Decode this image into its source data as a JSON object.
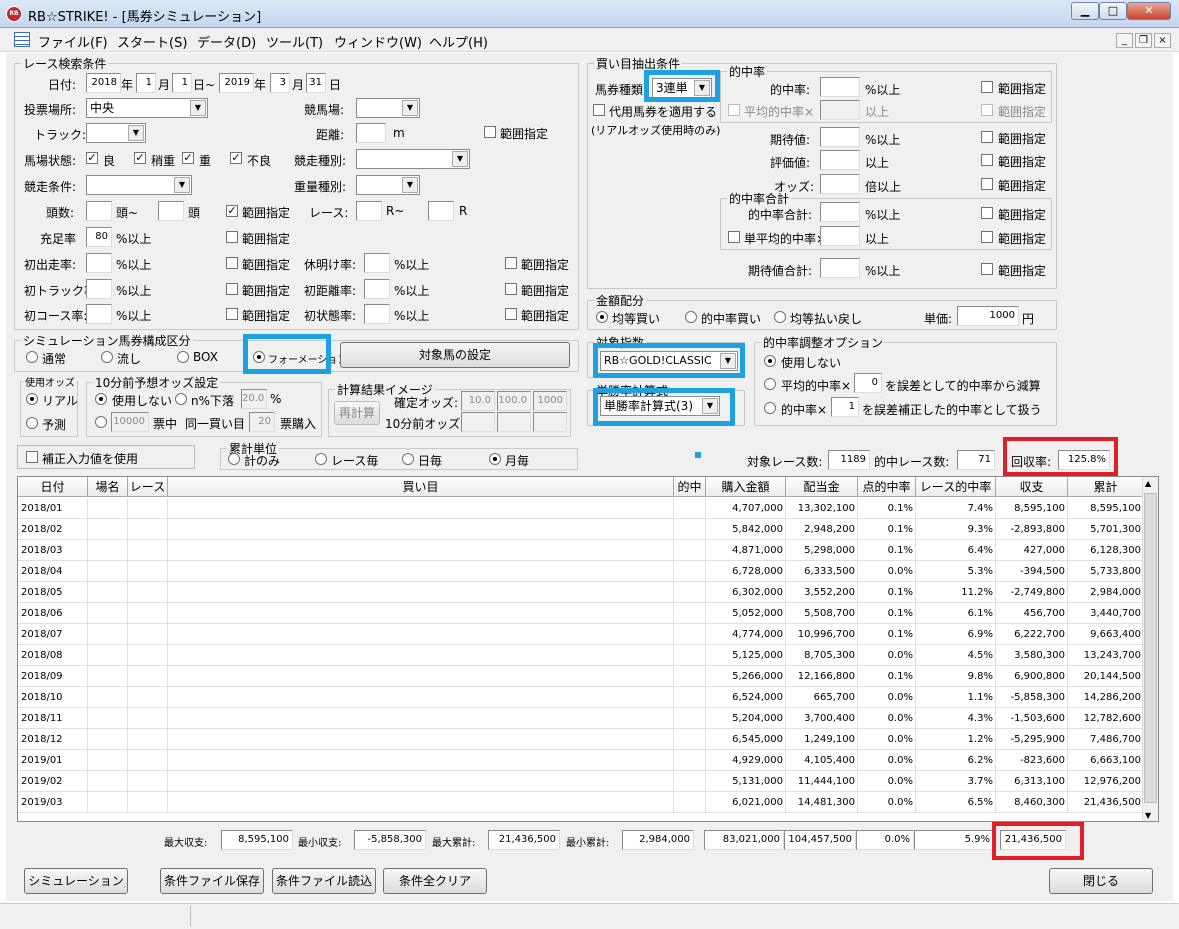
{
  "window": {
    "title": "RB☆STRIKE! - [馬券シミュレーション]",
    "logo_text": "RB",
    "min": "▁",
    "max": "□",
    "close": "✕"
  },
  "menu": [
    "ファイル(F)",
    "スタート(S)",
    "データ(D)",
    "ツール(T)",
    "ウィンドウ(W)",
    "ヘルプ(H)"
  ],
  "mdi": {
    "min": "_",
    "restore": "❐",
    "close": "×"
  },
  "race": {
    "legend": "レース検索条件",
    "date_label": "日付:",
    "from_year": "2018",
    "year_u": "年",
    "from_month": "1",
    "month_u": "月",
    "from_day": "1",
    "day_tilde": "日~",
    "to_year": "2019",
    "to_month": "3",
    "to_day": "31",
    "day_u": "日",
    "venue_label": "投票場所:",
    "venue_value": "中央",
    "course_label": "競馬場:",
    "track_label": "トラック:",
    "distance_label": "距離:",
    "distance_unit": "m",
    "range": "範囲指定",
    "cond_label": "馬場状態:",
    "cond": [
      "良",
      "稍重",
      "重",
      "不良"
    ],
    "race_type_label": "競走種別:",
    "race_cond_label": "競走条件:",
    "weight_label": "重量種別:",
    "heads_label": "頭数:",
    "heads_u": "頭~",
    "heads_u2": "頭",
    "race_label": "レース:",
    "race_u": "R~",
    "race_u2": "R",
    "fill_label": "充足率",
    "fill_value": "80",
    "pct_over": "%以上",
    "first_run": "初出走率:",
    "rest": "休明け率:",
    "first_track": "初トラック率:",
    "first_dist": "初距離率:",
    "first_course": "初コース率:",
    "first_state": "初状態率:"
  },
  "composition": {
    "legend": "シミュレーション馬券構成区分",
    "options": [
      "通常",
      "流し",
      "BOX",
      "フォーメーション"
    ],
    "button": "対象馬の設定"
  },
  "odds_use": {
    "legend": "使用オッズ",
    "options": [
      "リアル",
      "予測"
    ]
  },
  "odds10": {
    "legend": "10分前予想オッズ設定",
    "no_use": "使用しない",
    "drop": "n%下落",
    "drop_value": "20.0",
    "pct": "%",
    "amount": "10000",
    "ticket_u": "票中",
    "same": "同一買い目",
    "same_value": "20",
    "buy_u": "票購入"
  },
  "calc": {
    "legend": "計算結果イメージ",
    "button": "再計算",
    "confirmed": "確定オッズ:",
    "confirmed_vals": [
      "10.0",
      "100.0",
      "1000"
    ],
    "before10": "10分前オッズ:"
  },
  "correction": {
    "label": "補正入力値を使用"
  },
  "unit": {
    "legend": "累計単位",
    "options": [
      "計のみ",
      "レース毎",
      "日毎",
      "月毎"
    ]
  },
  "buy": {
    "legend": "買い目抽出条件",
    "type_label": "馬券種類",
    "type_value": "3連単",
    "substitute": "代用馬券を適用する",
    "real_note": "(リアルオッズ使用時のみ)",
    "hit_legend": "的中率",
    "hit_rate": "的中率:",
    "avg_hit": "平均的中率×",
    "expect": "期待値:",
    "eval": "評価値:",
    "odds": "オッズ:",
    "over": "%以上",
    "over2": "以上",
    "times": "倍以上",
    "sum_legend": "的中率合計",
    "sum_rate": "的中率合計:",
    "single_avg": "単平均的中率×",
    "expect_sum": "期待値合計:",
    "range": "範囲指定"
  },
  "money": {
    "legend": "金額配分",
    "options": [
      "均等買い",
      "的中率買い",
      "均等払い戻し"
    ],
    "unit_label": "単価:",
    "unit_value": "1000",
    "yen": "円"
  },
  "index": {
    "legend": "対象指数",
    "value": "RB☆GOLD!CLASSIC"
  },
  "formula": {
    "legend": "単勝率計算式",
    "value": "単勝率計算式(3)"
  },
  "adjust": {
    "legend": "的中率調整オプション",
    "no_use": "使用しない",
    "opt2_a": "平均的中率×",
    "opt2_val": "0",
    "opt2_b": "を誤差として的中率から減算",
    "opt3_a": "的中率×",
    "opt3_val": "1",
    "opt3_b": "を誤差補正した的中率として扱う"
  },
  "summary": {
    "races_label": "対象レース数:",
    "races": "1189",
    "hit_label": "的中レース数:",
    "hits": "71",
    "recovery_label": "回収率:",
    "recovery": "125.8%"
  },
  "table": {
    "headers": [
      "日付",
      "場名",
      "レース",
      "買い目",
      "的中",
      "購入金額",
      "配当金",
      "点的中率",
      "レース的中率",
      "収支",
      "累計"
    ],
    "rows": [
      [
        "2018/01",
        "4,707,000",
        "13,302,100",
        "0.1%",
        "7.4%",
        "8,595,100",
        "8,595,100"
      ],
      [
        "2018/02",
        "5,842,000",
        "2,948,200",
        "0.1%",
        "9.3%",
        "-2,893,800",
        "5,701,300"
      ],
      [
        "2018/03",
        "4,871,000",
        "5,298,000",
        "0.1%",
        "6.4%",
        "427,000",
        "6,128,300"
      ],
      [
        "2018/04",
        "6,728,000",
        "6,333,500",
        "0.0%",
        "5.3%",
        "-394,500",
        "5,733,800"
      ],
      [
        "2018/05",
        "6,302,000",
        "3,552,200",
        "0.1%",
        "11.2%",
        "-2,749,800",
        "2,984,000"
      ],
      [
        "2018/06",
        "5,052,000",
        "5,508,700",
        "0.1%",
        "6.1%",
        "456,700",
        "3,440,700"
      ],
      [
        "2018/07",
        "4,774,000",
        "10,996,700",
        "0.1%",
        "6.9%",
        "6,222,700",
        "9,663,400"
      ],
      [
        "2018/08",
        "5,125,000",
        "8,705,300",
        "0.0%",
        "4.5%",
        "3,580,300",
        "13,243,700"
      ],
      [
        "2018/09",
        "5,266,000",
        "12,166,800",
        "0.1%",
        "9.8%",
        "6,900,800",
        "20,144,500"
      ],
      [
        "2018/10",
        "6,524,000",
        "665,700",
        "0.0%",
        "1.1%",
        "-5,858,300",
        "14,286,200"
      ],
      [
        "2018/11",
        "5,204,000",
        "3,700,400",
        "0.0%",
        "4.3%",
        "-1,503,600",
        "12,782,600"
      ],
      [
        "2018/12",
        "6,545,000",
        "1,249,100",
        "0.0%",
        "1.2%",
        "-5,295,900",
        "7,486,700"
      ],
      [
        "2019/01",
        "4,929,000",
        "4,105,400",
        "0.0%",
        "6.2%",
        "-823,600",
        "6,663,100"
      ],
      [
        "2019/02",
        "5,131,000",
        "11,444,100",
        "0.0%",
        "3.7%",
        "6,313,100",
        "12,976,200"
      ],
      [
        "2019/03",
        "6,021,000",
        "14,481,300",
        "0.0%",
        "6.5%",
        "8,460,300",
        "21,436,500"
      ]
    ]
  },
  "footer": {
    "max_label": "最大収支:",
    "max": "8,595,100",
    "min_label": "最小収支:",
    "min": "-5,858,300",
    "maxcum_label": "最大累計:",
    "maxcum": "21,436,500",
    "mincum_label": "最小累計:",
    "mincum": "2,984,000",
    "buy_total": "83,021,000",
    "pay_total": "104,457,500",
    "point": "0.0%",
    "race_rate": "5.9%",
    "cum": "21,436,500"
  },
  "buttons": {
    "simulate": "シミュレーション",
    "save": "条件ファイル保存",
    "load": "条件ファイル読込",
    "clear": "条件全クリア",
    "close": "閉じる"
  }
}
